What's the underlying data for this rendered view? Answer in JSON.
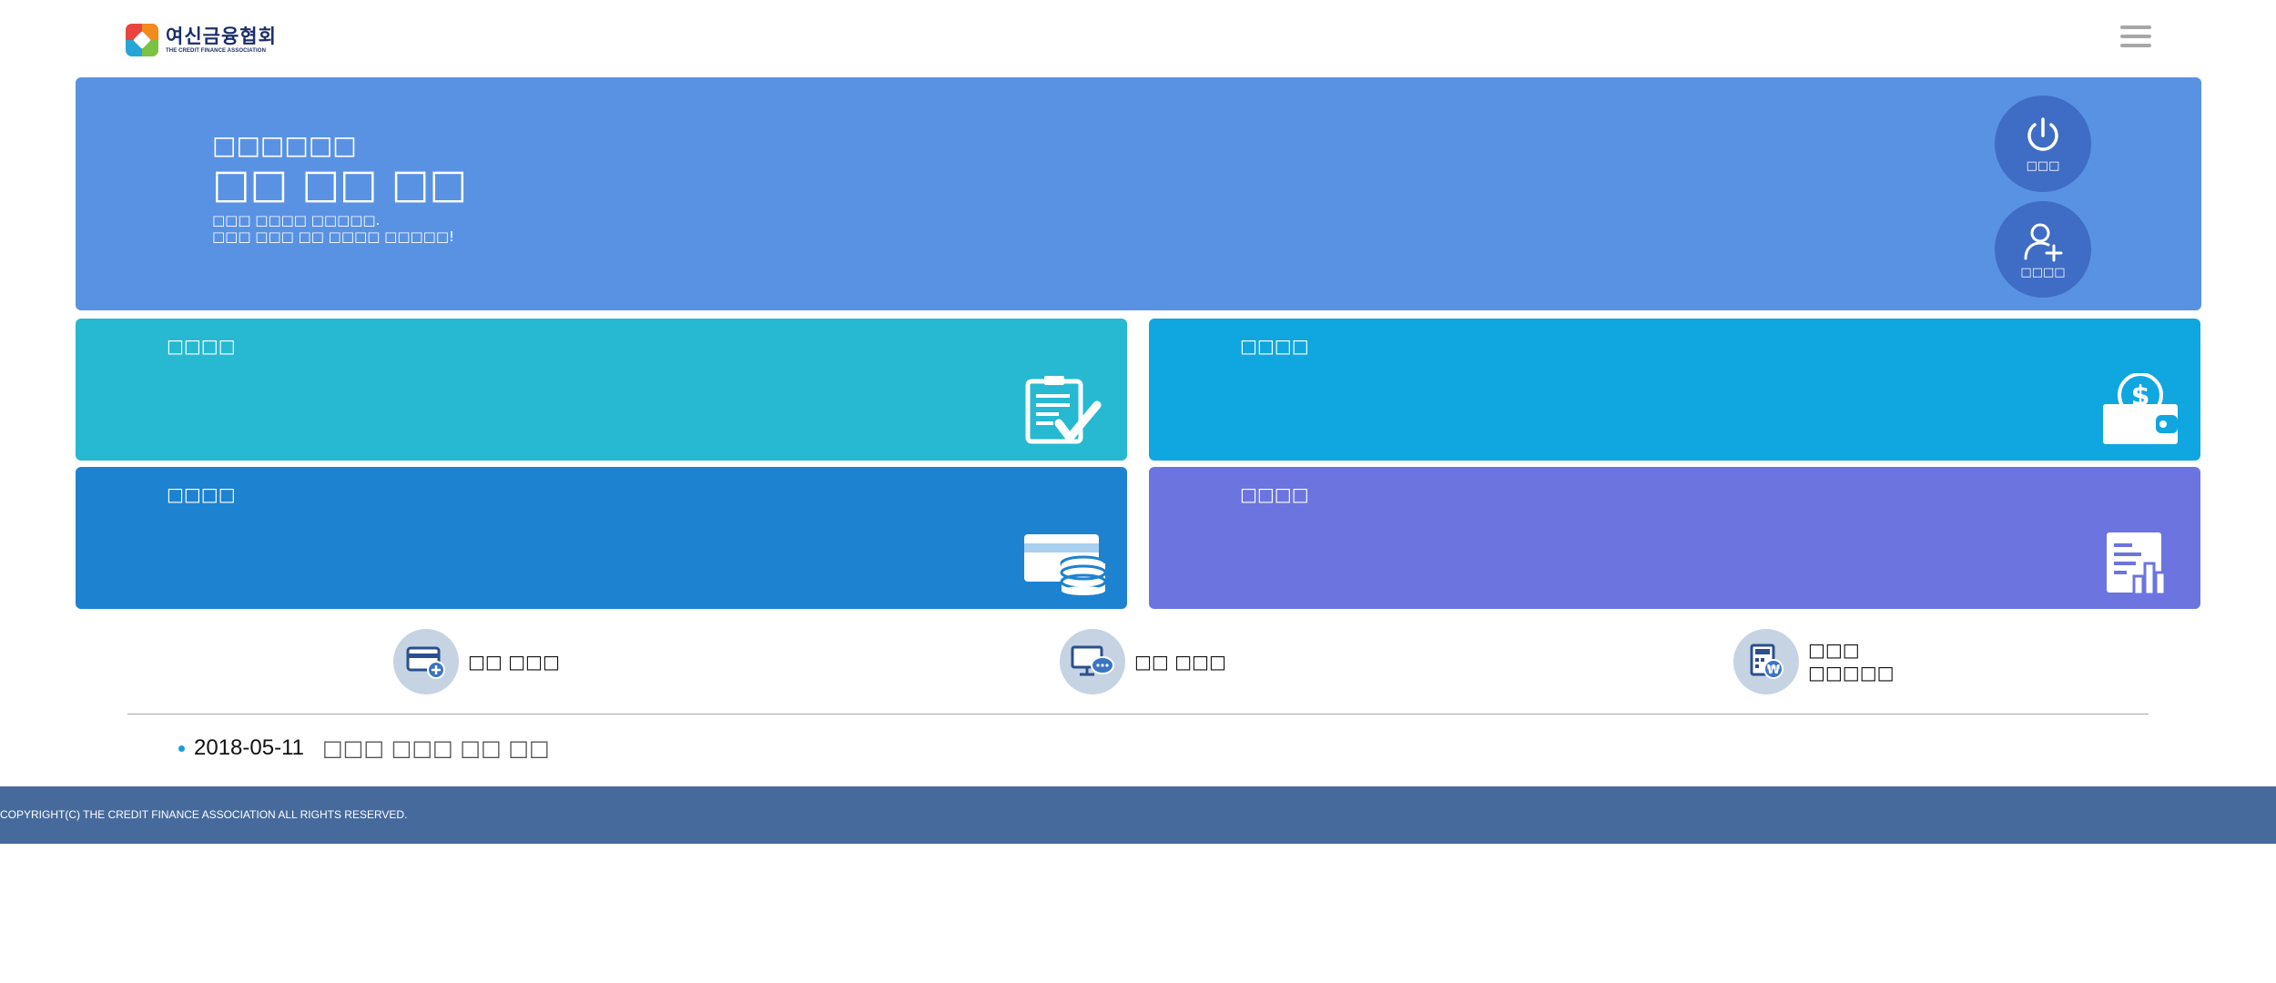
{
  "header": {
    "logo_ko": "여신금융협회",
    "logo_en": "THE CREDIT FINANCE ASSOCIATION"
  },
  "hero": {
    "subtitle": "□□□□□□",
    "title": "□□ □□ □□",
    "desc_line1": "□□□ □□□□ □□□□□.",
    "desc_line2": "□□□ □□□ □□ □□□□ □□□□□!",
    "login_label": "□□□",
    "join_label": "□□□□"
  },
  "tiles": [
    {
      "label": "□□□□",
      "icon": "clipboard-check-icon",
      "color": "#26b9d1"
    },
    {
      "label": "□□□□",
      "icon": "wallet-dollar-icon",
      "color": "#10a6e0"
    },
    {
      "label": "□□□□",
      "icon": "card-coins-icon",
      "color": "#1d82d0"
    },
    {
      "label": "□□□□",
      "icon": "document-chart-icon",
      "color": "#6b74df"
    }
  ],
  "quick_links": [
    {
      "label": "□□ □□□",
      "icon": "card-add-icon"
    },
    {
      "label": "□□ □□□",
      "icon": "monitor-chat-icon"
    },
    {
      "label_line1": "□□□",
      "label_line2": "□□□□□",
      "icon": "calculator-won-icon"
    }
  ],
  "notice": {
    "date": "2018-05-11",
    "title": "□□□ □□□ □□ □□"
  },
  "footer": {
    "copyright": "COPYRIGHT(C) THE CREDIT FINANCE ASSOCIATION ALL RIGHTS RESERVED."
  }
}
